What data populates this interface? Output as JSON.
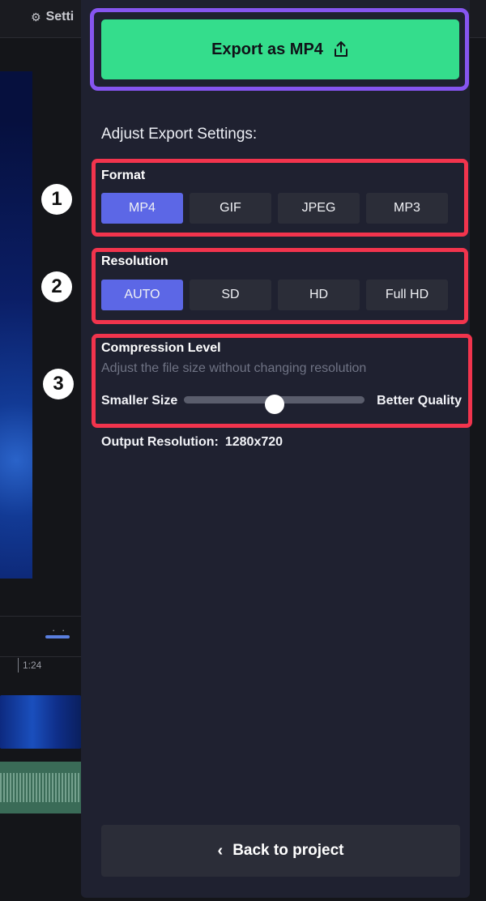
{
  "background": {
    "settings_label": "Setti",
    "timeline_time": "1:24"
  },
  "export": {
    "button_label": "Export as MP4",
    "icon": "share-export-icon"
  },
  "settings": {
    "title": "Adjust Export Settings:",
    "format": {
      "label": "Format",
      "options": [
        "MP4",
        "GIF",
        "JPEG",
        "MP3"
      ],
      "selected": "MP4"
    },
    "resolution": {
      "label": "Resolution",
      "options": [
        "AUTO",
        "SD",
        "HD",
        "Full HD"
      ],
      "selected": "AUTO"
    },
    "compression": {
      "label": "Compression Level",
      "hint": "Adjust the file size without changing resolution",
      "min_label": "Smaller Size",
      "max_label": "Better Quality",
      "value_fraction": 0.5
    },
    "output": {
      "label": "Output Resolution:",
      "value": "1280x720"
    }
  },
  "annotations": [
    "1",
    "2",
    "3"
  ],
  "back_button": {
    "label": "Back to project",
    "icon": "chevron-left-icon"
  },
  "colors": {
    "export_green": "#34dd8c",
    "active_blue": "#5c67e6",
    "highlight_purple": "#8655f0",
    "highlight_red": "#f2344d",
    "panel_bg": "#1f2130"
  }
}
